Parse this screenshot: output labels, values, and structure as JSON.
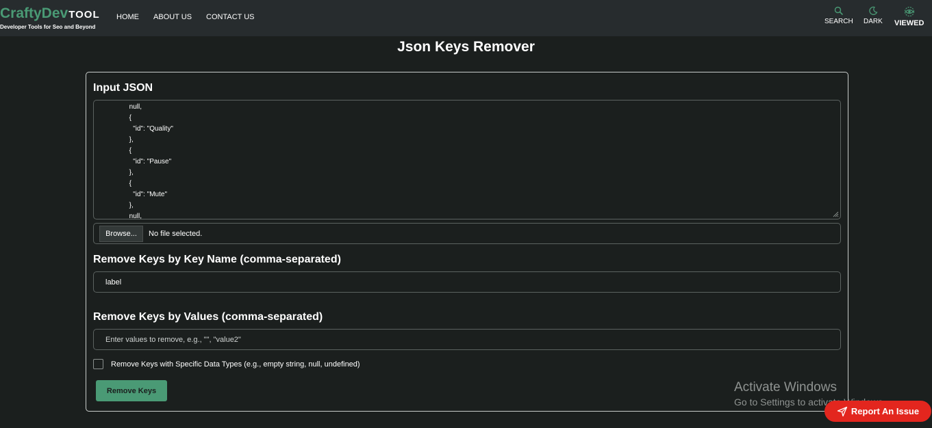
{
  "header": {
    "logo": {
      "crafty": "CraftyDev",
      "tool": "TOOL",
      "tagline": "Developer Tools for Seo and Beyond"
    },
    "nav": [
      "HOME",
      "ABOUT US",
      "CONTACT US"
    ],
    "tools": [
      {
        "label": "SEARCH",
        "icon": "search-icon"
      },
      {
        "label": "DARK",
        "icon": "moon-icon"
      },
      {
        "label": "VIEWED",
        "icon": "eye-icon"
      }
    ],
    "accent_color": "#4a9a75"
  },
  "page": {
    "title": "Json Keys Remover"
  },
  "form": {
    "input_label": "Input JSON",
    "json_value": "      null,\n      {\n        \"id\": \"Quality\"\n      },\n      {\n        \"id\": \"Pause\"\n      },\n      {\n        \"id\": \"Mute\"\n      },\n      null,",
    "browse_label": "Browse...",
    "file_status": "No file selected.",
    "keys_label": "Remove Keys by Key Name (comma-separated)",
    "keys_value": "label",
    "values_label": "Remove Keys by Values (comma-separated)",
    "values_placeholder": "Enter values to remove, e.g., \"\", \"value2\"",
    "datatype_label": "Remove Keys with Specific Data Types (e.g., empty string, null, undefined)",
    "datatype_checked": false,
    "submit_label": "Remove Keys"
  },
  "watermark": {
    "title": "Activate Windows",
    "subtitle": "Go to Settings to activate Windows."
  },
  "report": {
    "label": "Report An Issue",
    "color": "#e3261e",
    "icon": "send-icon"
  }
}
